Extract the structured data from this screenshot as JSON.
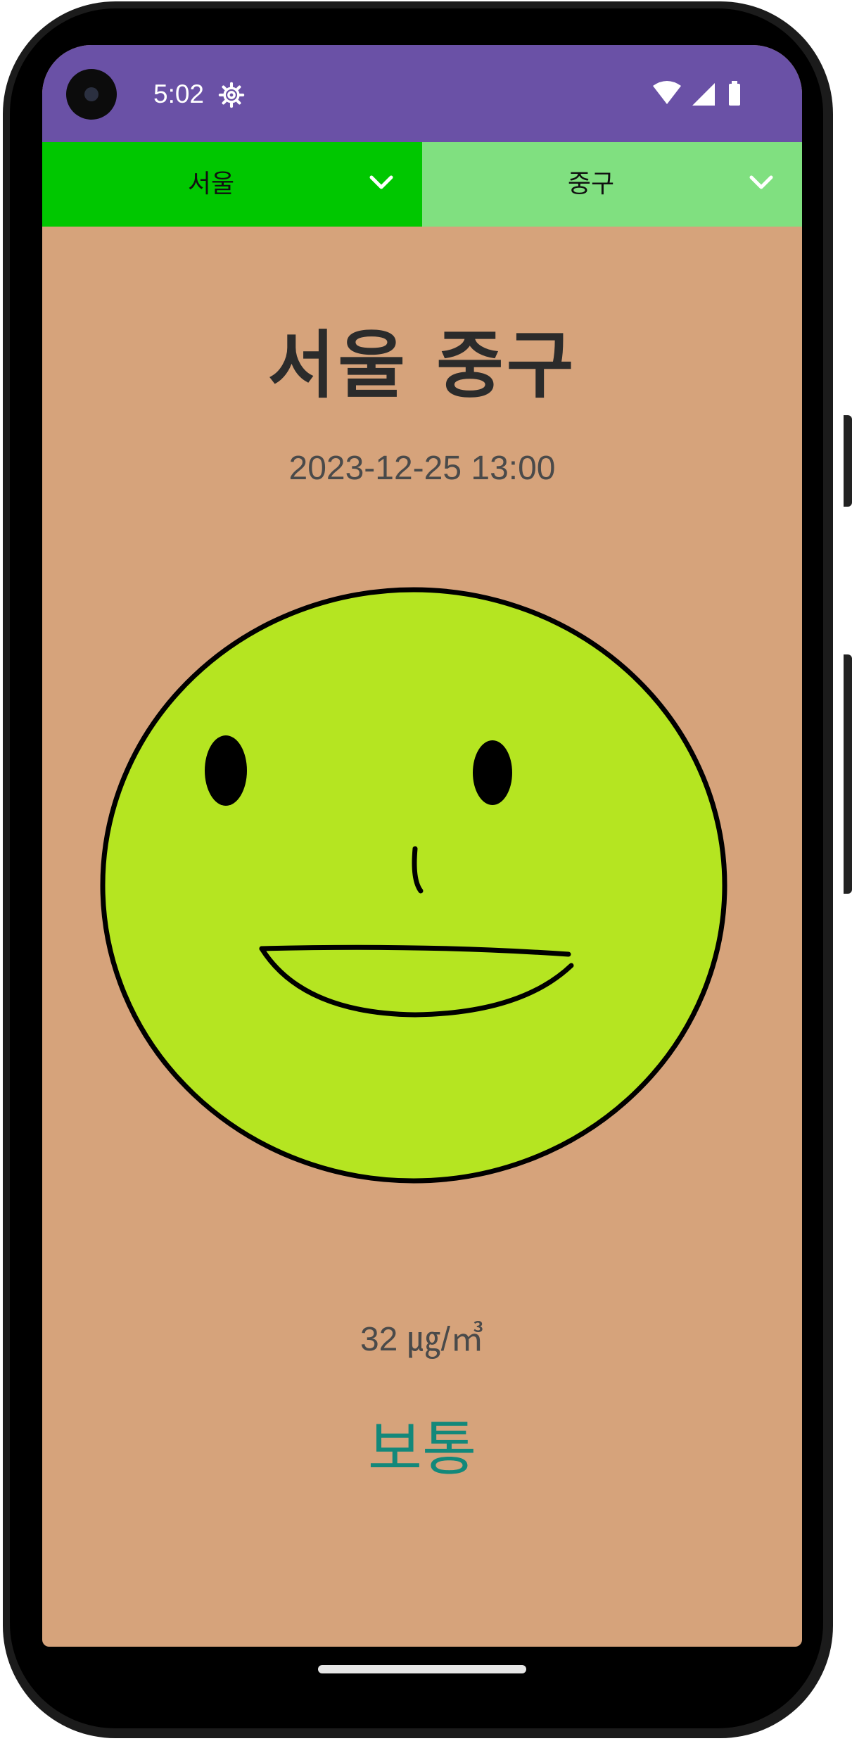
{
  "status_bar": {
    "time": "5:02",
    "background_color": "#6a51a6",
    "icons": [
      "camera-hole",
      "settings-gear-icon",
      "wifi-icon",
      "cellular-signal-icon",
      "battery-icon"
    ]
  },
  "spinners": {
    "city": {
      "selected": "서울",
      "background_color": "#00c700",
      "icon": "chevron-down-icon"
    },
    "district": {
      "selected": "중구",
      "background_color": "#80e080",
      "icon": "chevron-down-icon"
    }
  },
  "main": {
    "location_title": "서울 중구",
    "measured_at": "2023-12-25 13:00",
    "face_icon": "smiley-face-icon",
    "face_color": "#b5e521",
    "background_color": "#d6a37b",
    "concentration": "32 ㎍/㎥",
    "grade": "보통",
    "grade_color": "#13887a"
  }
}
